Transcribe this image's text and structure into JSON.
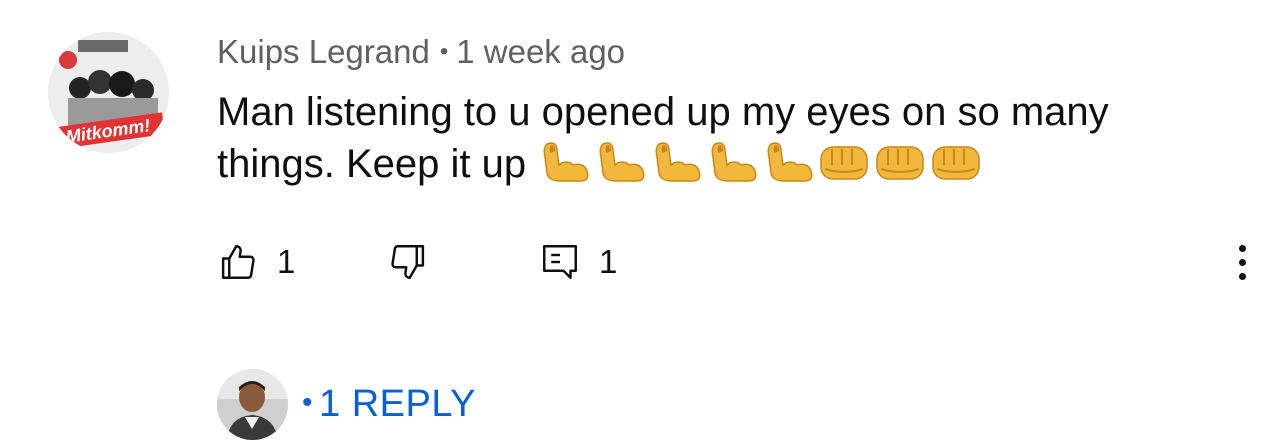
{
  "comment": {
    "author": "Kuips Legrand",
    "separator": "•",
    "timestamp": "1 week ago",
    "text": "Man listening to u opened up my eyes on so many things. Keep it up",
    "emojis": [
      "flexed-biceps",
      "flexed-biceps",
      "flexed-biceps",
      "flexed-biceps",
      "flexed-biceps",
      "oncoming-fist",
      "oncoming-fist",
      "oncoming-fist"
    ],
    "avatar_text": "Mitkomm!"
  },
  "actions": {
    "like_count": "1",
    "reply_count": "1",
    "like_icon": "thumbs-up-icon",
    "dislike_icon": "thumbs-down-icon",
    "reply_icon": "comment-icon",
    "more_icon": "more-vertical-icon"
  },
  "replies": {
    "separator": "•",
    "label": "1 REPLY",
    "link_color": "#065fd4"
  }
}
